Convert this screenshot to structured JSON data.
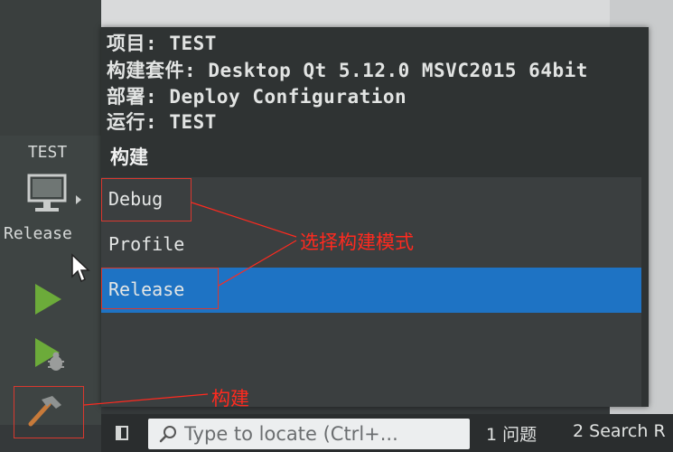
{
  "kit_selector": {
    "project_name": "TEST",
    "build_config": "Release",
    "icon": "monitor-icon"
  },
  "popup": {
    "info_lines": [
      {
        "label": "项目:",
        "value": "TEST"
      },
      {
        "label": "构建套件:",
        "value": "Desktop Qt 5.12.0 MSVC2015 64bit"
      },
      {
        "label": "部署:",
        "value": "Deploy Configuration"
      },
      {
        "label": "运行:",
        "value": "TEST"
      }
    ],
    "section_title": "构建",
    "options": [
      "Debug",
      "Profile",
      "Release"
    ],
    "selected_option": "Release"
  },
  "annotations": {
    "select_mode": "选择构建模式",
    "build": "构建"
  },
  "bottom_bar": {
    "locator_placeholder": "Type to locate (Ctrl+...",
    "tabs": [
      {
        "number": "1",
        "label": "问题"
      },
      {
        "number": "2",
        "label": "Search R"
      }
    ]
  },
  "colors": {
    "selection": "#1e73c4",
    "annotation": "#ff2a1f"
  }
}
